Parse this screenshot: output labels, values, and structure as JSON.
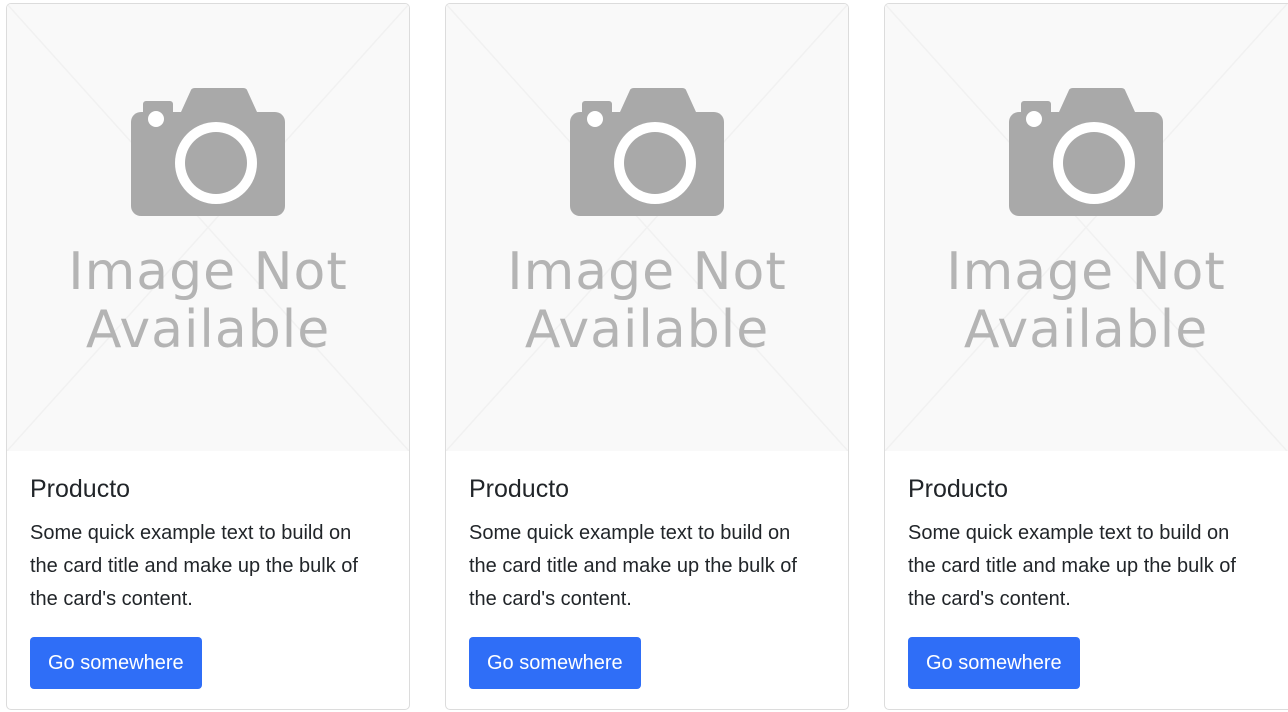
{
  "cards": [
    {
      "image_text_line1": "Image Not",
      "image_text_line2": "Available",
      "title": "Producto",
      "text": "Some quick example text to build on the card title and make up the bulk of the card's content.",
      "button_label": "Go somewhere"
    },
    {
      "image_text_line1": "Image Not",
      "image_text_line2": "Available",
      "title": "Producto",
      "text": "Some quick example text to build on the card title and make up the bulk of the card's content.",
      "button_label": "Go somewhere"
    },
    {
      "image_text_line1": "Image Not",
      "image_text_line2": "Available",
      "title": "Producto",
      "text": "Some quick example text to build on the card title and make up the bulk of the card's content.",
      "button_label": "Go somewhere"
    }
  ],
  "colors": {
    "button": "#2f6ef7",
    "placeholder_icon": "#a9a9a9",
    "placeholder_bg": "#f9f9f9"
  },
  "icons": {
    "placeholder": "camera-icon"
  }
}
